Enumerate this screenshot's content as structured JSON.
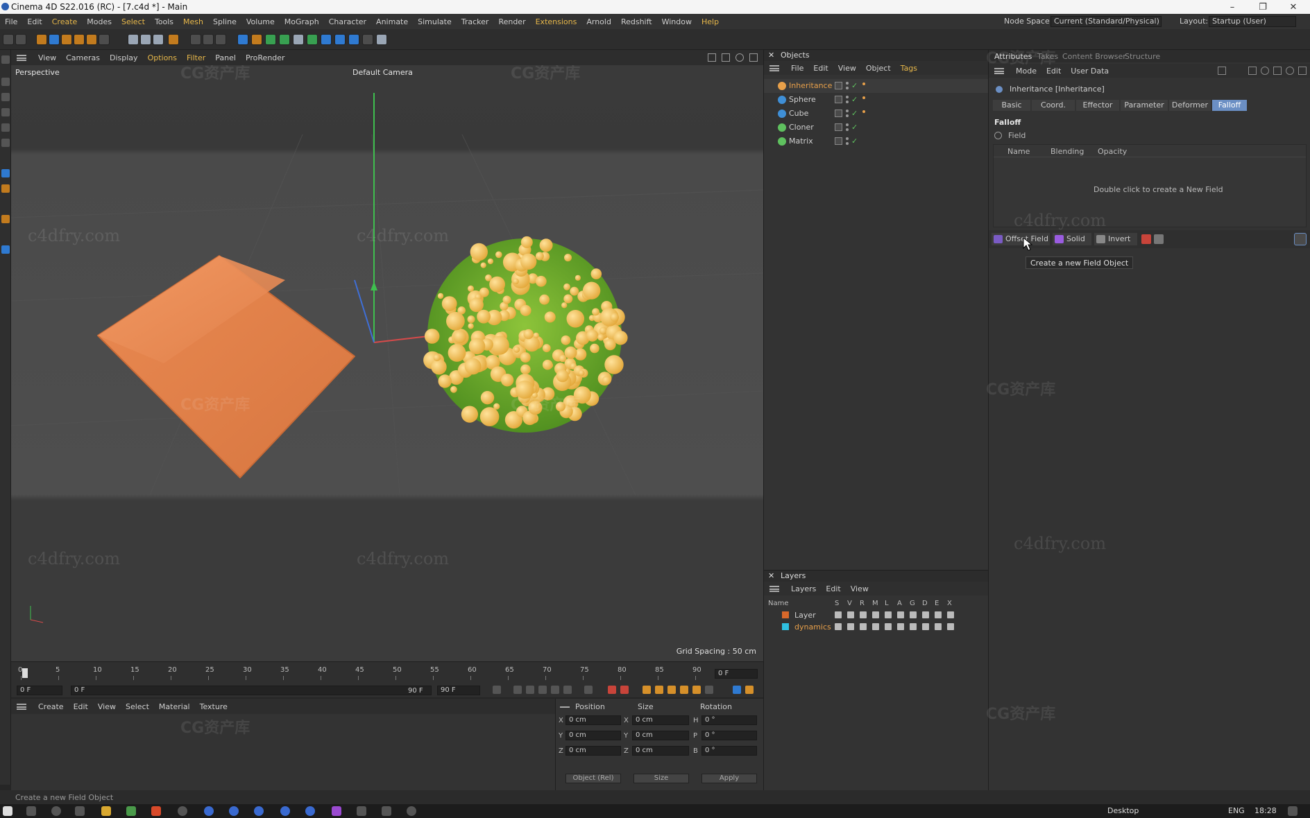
{
  "window": {
    "title": "Cinema 4D S22.016 (RC) - [7.c4d *] - Main",
    "controls": [
      "–",
      "❐",
      "✕"
    ]
  },
  "menu": {
    "items": [
      "File",
      "Edit",
      "Create",
      "Modes",
      "Select",
      "Tools",
      "Mesh",
      "Spline",
      "Volume",
      "MoGraph",
      "Character",
      "Animate",
      "Simulate",
      "Tracker",
      "Render",
      "Extensions",
      "Arnold",
      "Redshift",
      "Window",
      "Help"
    ],
    "node_space_label": "Node Space:",
    "node_space_value": "Current (Standard/Physical)",
    "layout_label": "Layout:",
    "layout_value": "Startup (User)"
  },
  "viewport": {
    "menu": [
      "View",
      "Cameras",
      "Display",
      "Options",
      "Filter",
      "Panel",
      "ProRender"
    ],
    "label": "Perspective",
    "camera": "Default Camera",
    "grid_spacing": "Grid Spacing : 50 cm"
  },
  "watermarks": {
    "cn": "CG资产库",
    "url": "c4dfry.com"
  },
  "timeline": {
    "ticks": [
      "0",
      "5",
      "10",
      "15",
      "20",
      "25",
      "30",
      "35",
      "40",
      "45",
      "50",
      "55",
      "60",
      "65",
      "70",
      "75",
      "80",
      "85",
      "90"
    ],
    "current_frame": "0 F",
    "start": "0 F",
    "range_start": "0 F",
    "range_end": "90 F",
    "end": "90 F",
    "frame_right": "0 F"
  },
  "material": {
    "menu": [
      "Create",
      "Edit",
      "View",
      "Select",
      "Material",
      "Texture"
    ]
  },
  "coords": {
    "headers": [
      "Position",
      "Size",
      "Rotation"
    ],
    "rows": [
      {
        "axis": "X",
        "pos": "0 cm",
        "size_axis": "X",
        "size": "0 cm",
        "rot_axis": "H",
        "rot": "0 °"
      },
      {
        "axis": "Y",
        "pos": "0 cm",
        "size_axis": "Y",
        "size": "0 cm",
        "rot_axis": "P",
        "rot": "0 °"
      },
      {
        "axis": "Z",
        "pos": "0 cm",
        "size_axis": "Z",
        "size": "0 cm",
        "rot_axis": "B",
        "rot": "0 °"
      }
    ],
    "mode": "Object (Rel)",
    "size_mode": "Size",
    "apply": "Apply"
  },
  "objects": {
    "title": "Objects",
    "menu": [
      "File",
      "Edit",
      "View",
      "Object",
      "Tags"
    ],
    "items": [
      {
        "name": "Inheritance",
        "color": "#e8a04a",
        "selected": true
      },
      {
        "name": "Sphere",
        "color": "#3f8fd6"
      },
      {
        "name": "Cube",
        "color": "#3f8fd6"
      },
      {
        "name": "Cloner",
        "color": "#5fc15f"
      },
      {
        "name": "Matrix",
        "color": "#5fc15f"
      }
    ]
  },
  "layers": {
    "title": "Layers",
    "menu": [
      "Layers",
      "Edit",
      "View"
    ],
    "columns": [
      "Name",
      "S",
      "V",
      "R",
      "M",
      "L",
      "A",
      "G",
      "D",
      "E",
      "X"
    ],
    "items": [
      {
        "name": "Layer",
        "color": "#d8682a",
        "text_color": "#d0d0d0"
      },
      {
        "name": "dynamics",
        "color": "#2fc0e0",
        "text_color": "#e8a04a"
      }
    ]
  },
  "attributes": {
    "tabs": [
      "Attributes",
      "Takes",
      "Content Browser",
      "Structure"
    ],
    "menu": [
      "Mode",
      "Edit",
      "User Data"
    ],
    "object_title": "Inheritance [Inheritance]",
    "subtabs": [
      "Basic",
      "Coord.",
      "Effector",
      "Parameter",
      "Deformer",
      "Falloff"
    ],
    "section": "Falloff",
    "field_label": "Field",
    "field_columns": [
      "Name",
      "Blending",
      "Opacity"
    ],
    "empty_hint": "Double click to create a New Field",
    "field_buttons": [
      "Offset Field",
      "Solid",
      "Invert"
    ],
    "tooltip": "Create a new Field Object"
  },
  "status": {
    "text": "Create a new Field Object"
  },
  "taskbar": {
    "desktop": "Desktop",
    "lang": "ENG",
    "time": "18:28"
  }
}
